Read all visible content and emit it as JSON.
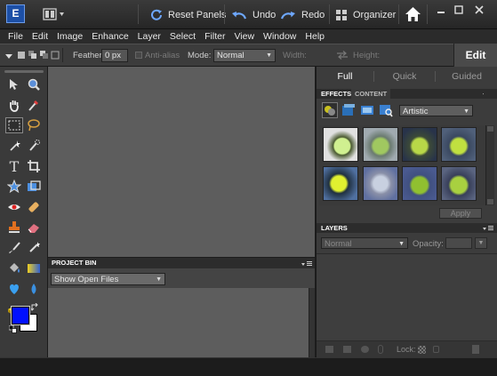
{
  "titlebar": {
    "app_logo": "E",
    "reset_label": "Reset Panels",
    "undo_label": "Undo",
    "redo_label": "Redo",
    "organizer_label": "Organizer"
  },
  "menu": [
    "File",
    "Edit",
    "Image",
    "Enhance",
    "Layer",
    "Select",
    "Filter",
    "View",
    "Window",
    "Help"
  ],
  "options": {
    "feather_label": "Feather:",
    "feather_value": "0 px",
    "antialias_label": "Anti-alias",
    "mode_label": "Mode:",
    "mode_value": "Normal",
    "width_label": "Width:",
    "height_label": "Height:",
    "edit_tab": "Edit"
  },
  "right_panel": {
    "tabs": [
      "Full",
      "Quick",
      "Guided"
    ],
    "effects_tab": "EFFECTS",
    "content_tab": "CONTENT",
    "effects_category": "Artistic",
    "apply_label": "Apply",
    "layers_title": "LAYERS",
    "blend_mode": "Normal",
    "opacity_label": "Opacity:",
    "lock_label": "Lock:"
  },
  "project_bin": {
    "title": "PROJECT BIN",
    "show_value": "Show Open Files"
  },
  "colors": {
    "foreground": "#0010ff",
    "background": "#ffffff",
    "canvas": "#5d5d5d",
    "panel": "#3c3c3c"
  }
}
